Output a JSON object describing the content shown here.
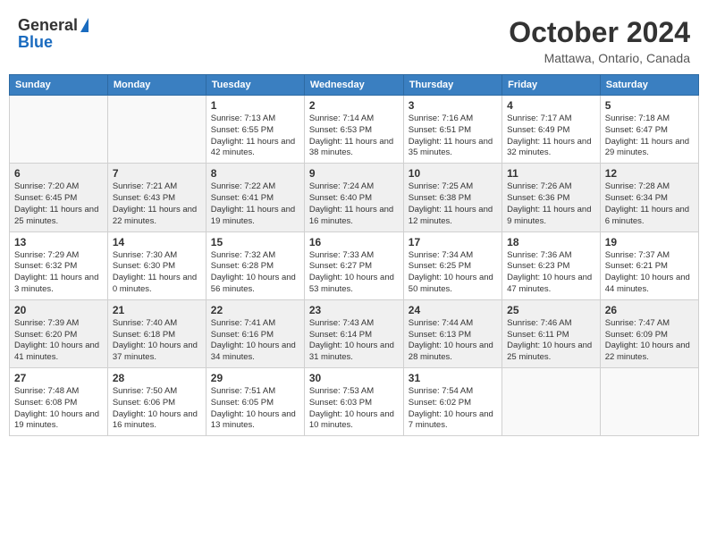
{
  "header": {
    "logo_general": "General",
    "logo_blue": "Blue",
    "month": "October 2024",
    "location": "Mattawa, Ontario, Canada"
  },
  "weekdays": [
    "Sunday",
    "Monday",
    "Tuesday",
    "Wednesday",
    "Thursday",
    "Friday",
    "Saturday"
  ],
  "weeks": [
    [
      {
        "day": "",
        "text": ""
      },
      {
        "day": "",
        "text": ""
      },
      {
        "day": "1",
        "text": "Sunrise: 7:13 AM\nSunset: 6:55 PM\nDaylight: 11 hours and 42 minutes."
      },
      {
        "day": "2",
        "text": "Sunrise: 7:14 AM\nSunset: 6:53 PM\nDaylight: 11 hours and 38 minutes."
      },
      {
        "day": "3",
        "text": "Sunrise: 7:16 AM\nSunset: 6:51 PM\nDaylight: 11 hours and 35 minutes."
      },
      {
        "day": "4",
        "text": "Sunrise: 7:17 AM\nSunset: 6:49 PM\nDaylight: 11 hours and 32 minutes."
      },
      {
        "day": "5",
        "text": "Sunrise: 7:18 AM\nSunset: 6:47 PM\nDaylight: 11 hours and 29 minutes."
      }
    ],
    [
      {
        "day": "6",
        "text": "Sunrise: 7:20 AM\nSunset: 6:45 PM\nDaylight: 11 hours and 25 minutes."
      },
      {
        "day": "7",
        "text": "Sunrise: 7:21 AM\nSunset: 6:43 PM\nDaylight: 11 hours and 22 minutes."
      },
      {
        "day": "8",
        "text": "Sunrise: 7:22 AM\nSunset: 6:41 PM\nDaylight: 11 hours and 19 minutes."
      },
      {
        "day": "9",
        "text": "Sunrise: 7:24 AM\nSunset: 6:40 PM\nDaylight: 11 hours and 16 minutes."
      },
      {
        "day": "10",
        "text": "Sunrise: 7:25 AM\nSunset: 6:38 PM\nDaylight: 11 hours and 12 minutes."
      },
      {
        "day": "11",
        "text": "Sunrise: 7:26 AM\nSunset: 6:36 PM\nDaylight: 11 hours and 9 minutes."
      },
      {
        "day": "12",
        "text": "Sunrise: 7:28 AM\nSunset: 6:34 PM\nDaylight: 11 hours and 6 minutes."
      }
    ],
    [
      {
        "day": "13",
        "text": "Sunrise: 7:29 AM\nSunset: 6:32 PM\nDaylight: 11 hours and 3 minutes."
      },
      {
        "day": "14",
        "text": "Sunrise: 7:30 AM\nSunset: 6:30 PM\nDaylight: 11 hours and 0 minutes."
      },
      {
        "day": "15",
        "text": "Sunrise: 7:32 AM\nSunset: 6:28 PM\nDaylight: 10 hours and 56 minutes."
      },
      {
        "day": "16",
        "text": "Sunrise: 7:33 AM\nSunset: 6:27 PM\nDaylight: 10 hours and 53 minutes."
      },
      {
        "day": "17",
        "text": "Sunrise: 7:34 AM\nSunset: 6:25 PM\nDaylight: 10 hours and 50 minutes."
      },
      {
        "day": "18",
        "text": "Sunrise: 7:36 AM\nSunset: 6:23 PM\nDaylight: 10 hours and 47 minutes."
      },
      {
        "day": "19",
        "text": "Sunrise: 7:37 AM\nSunset: 6:21 PM\nDaylight: 10 hours and 44 minutes."
      }
    ],
    [
      {
        "day": "20",
        "text": "Sunrise: 7:39 AM\nSunset: 6:20 PM\nDaylight: 10 hours and 41 minutes."
      },
      {
        "day": "21",
        "text": "Sunrise: 7:40 AM\nSunset: 6:18 PM\nDaylight: 10 hours and 37 minutes."
      },
      {
        "day": "22",
        "text": "Sunrise: 7:41 AM\nSunset: 6:16 PM\nDaylight: 10 hours and 34 minutes."
      },
      {
        "day": "23",
        "text": "Sunrise: 7:43 AM\nSunset: 6:14 PM\nDaylight: 10 hours and 31 minutes."
      },
      {
        "day": "24",
        "text": "Sunrise: 7:44 AM\nSunset: 6:13 PM\nDaylight: 10 hours and 28 minutes."
      },
      {
        "day": "25",
        "text": "Sunrise: 7:46 AM\nSunset: 6:11 PM\nDaylight: 10 hours and 25 minutes."
      },
      {
        "day": "26",
        "text": "Sunrise: 7:47 AM\nSunset: 6:09 PM\nDaylight: 10 hours and 22 minutes."
      }
    ],
    [
      {
        "day": "27",
        "text": "Sunrise: 7:48 AM\nSunset: 6:08 PM\nDaylight: 10 hours and 19 minutes."
      },
      {
        "day": "28",
        "text": "Sunrise: 7:50 AM\nSunset: 6:06 PM\nDaylight: 10 hours and 16 minutes."
      },
      {
        "day": "29",
        "text": "Sunrise: 7:51 AM\nSunset: 6:05 PM\nDaylight: 10 hours and 13 minutes."
      },
      {
        "day": "30",
        "text": "Sunrise: 7:53 AM\nSunset: 6:03 PM\nDaylight: 10 hours and 10 minutes."
      },
      {
        "day": "31",
        "text": "Sunrise: 7:54 AM\nSunset: 6:02 PM\nDaylight: 10 hours and 7 minutes."
      },
      {
        "day": "",
        "text": ""
      },
      {
        "day": "",
        "text": ""
      }
    ]
  ]
}
